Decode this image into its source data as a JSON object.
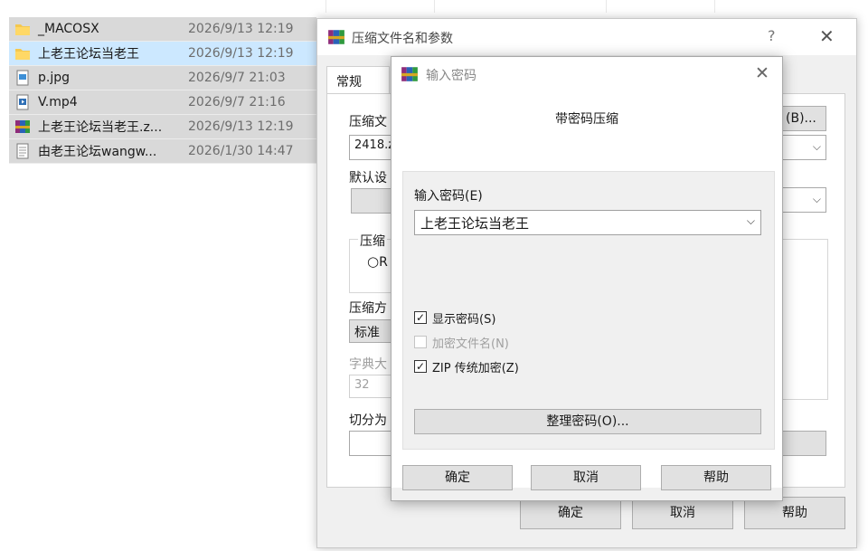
{
  "explorer": {
    "files": [
      {
        "name": "_MACOSX",
        "date": "2026/9/13 12:19",
        "icon": "folder-icon"
      },
      {
        "name": "上老王论坛当老王",
        "date": "2026/9/13 12:19",
        "icon": "folder-icon"
      },
      {
        "name": "p.jpg",
        "date": "2026/9/7 21:03",
        "icon": "image-file-icon"
      },
      {
        "name": "V.mp4",
        "date": "2026/9/7 21:16",
        "icon": "video-file-icon"
      },
      {
        "name": "上老王论坛当老王.z...",
        "date": "2026/9/13 12:19",
        "icon": "winrar-archive-icon"
      },
      {
        "name": "由老王论坛wangw...",
        "date": "2026/1/30 14:47",
        "icon": "text-file-icon"
      }
    ]
  },
  "main_dialog": {
    "title": "压缩文件名和参数",
    "help": "?",
    "close": "✕",
    "tab_general": "常规",
    "archive_name_label": "压缩文",
    "archive_name_value": "2418.z",
    "browse_button": "(B)...",
    "default_settings_label": "默认设",
    "format_group_label": "压缩",
    "format_option": "R",
    "method_label": "压缩方",
    "method_value": "标准",
    "dict_label": "字典大",
    "dict_value": "32",
    "split_label": "切分为",
    "ok": "确定",
    "cancel": "取消",
    "help_button": "帮助"
  },
  "password_dialog": {
    "title": "输入密码",
    "close": "✕",
    "heading": "带密码压缩",
    "enter_password_label": "输入密码(E)",
    "password_value": "上老王论坛当老王",
    "show_password": {
      "label": "显示密码(S)",
      "checked": true
    },
    "encrypt_names": {
      "label": "加密文件名(N)",
      "checked": false
    },
    "zip_legacy": {
      "label": "ZIP 传统加密(Z)",
      "checked": true
    },
    "organize_button": "整理密码(O)...",
    "ok": "确定",
    "cancel": "取消",
    "help": "帮助"
  },
  "colors": {
    "selection": "#cce8ff",
    "row_gray": "#d9d9d9",
    "dialog_bg": "#f0f0f0",
    "button_bg": "#e1e1e1"
  }
}
